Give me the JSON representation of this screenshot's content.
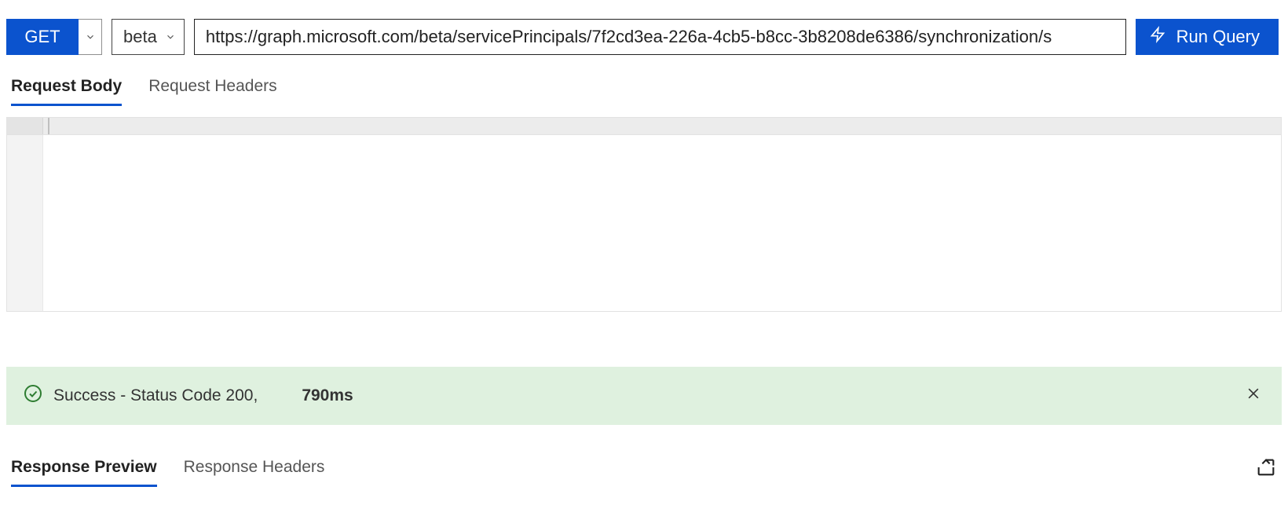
{
  "query": {
    "method": "GET",
    "version": "beta",
    "url": "https://graph.microsoft.com/beta/servicePrincipals/7f2cd3ea-226a-4cb5-b8cc-3b8208de6386/synchronization/s",
    "run_label": "Run Query"
  },
  "request_tabs": {
    "body": "Request Body",
    "headers": "Request Headers"
  },
  "request_body": "",
  "status": {
    "message": "Success - Status Code 200,",
    "time": "790ms"
  },
  "response_tabs": {
    "preview": "Response Preview",
    "headers": "Response Headers"
  }
}
